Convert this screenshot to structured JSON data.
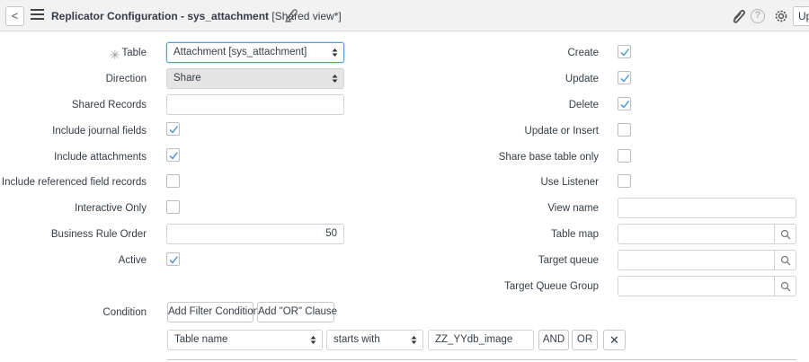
{
  "header": {
    "back_label": "<",
    "record_title": "Replicator Configuration - sys_attachment",
    "view_label": "[Shared view*]",
    "help_label": "?",
    "update_label": "Update"
  },
  "form": {
    "table": {
      "label": "Table",
      "value": "Attachment [sys_attachment]"
    },
    "direction": {
      "label": "Direction",
      "value": "Share"
    },
    "shared_records": {
      "label": "Shared Records",
      "value": ""
    },
    "include_journal_fields": {
      "label": "Include journal fields",
      "checked": true
    },
    "include_attachments": {
      "label": "Include attachments",
      "checked": true
    },
    "include_referenced": {
      "label": "Include referenced field records",
      "checked": false
    },
    "interactive_only": {
      "label": "Interactive Only",
      "checked": false
    },
    "business_rule_order": {
      "label": "Business Rule Order",
      "value": "50"
    },
    "active": {
      "label": "Active",
      "checked": true
    },
    "create": {
      "label": "Create",
      "checked": true
    },
    "update": {
      "label": "Update",
      "checked": true
    },
    "delete": {
      "label": "Delete",
      "checked": true
    },
    "update_or_insert": {
      "label": "Update or Insert",
      "checked": false
    },
    "share_base_table_only": {
      "label": "Share base table only",
      "checked": false
    },
    "use_listener": {
      "label": "Use Listener",
      "checked": false
    },
    "view_name": {
      "label": "View name",
      "value": ""
    },
    "table_map": {
      "label": "Table map",
      "value": ""
    },
    "target_queue": {
      "label": "Target queue",
      "value": ""
    },
    "target_queue_group": {
      "label": "Target Queue Group",
      "value": ""
    }
  },
  "condition": {
    "label": "Condition",
    "add_filter_label": "Add Filter Condition",
    "add_or_label": "Add \"OR\" Clause",
    "field": "Table name",
    "operator": "starts with",
    "value": "ZZ_YYdb_image",
    "and_label": "AND",
    "or_label": "OR",
    "remove_label": "✕"
  },
  "colors": {
    "accent": "#5a9ad8",
    "check": "#3c8dd6",
    "header_bg": "#f2f2f2"
  }
}
